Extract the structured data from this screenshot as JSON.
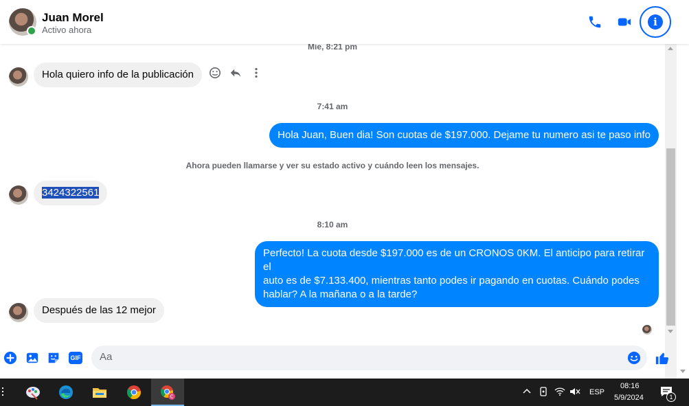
{
  "header": {
    "contact_name": "Juan Morel",
    "contact_status": "Activo ahora"
  },
  "conversation": {
    "timestamp_1": "Mie, 8:21 pm",
    "msg_1": "Hola quiero info de la publicación",
    "timestamp_2": "7:41 am",
    "msg_2": "Hola Juan, Buen dia! Son cuotas de $197.000. Dejame tu numero asi te paso info",
    "system_note": "Ahora pueden llamarse y ver su estado activo y cuándo leen los mensajes.",
    "msg_3": "3424322561",
    "timestamp_3": "8:10 am",
    "msg_4_line1": "Perfecto! La cuota desde $197.000 es de un CRONOS 0KM. El anticipo para retirar el",
    "msg_4_line2": "auto es de $7.133.400, mientras tanto podes ir pagando en cuotas. Cuándo podes",
    "msg_4_line3": "hablar? A la mañana o a la tarde?",
    "msg_5": "Después de las 12 mejor"
  },
  "composer": {
    "placeholder": "Aa",
    "gif_label": "GIF"
  },
  "taskbar": {
    "language": "ESP",
    "time": "08:16",
    "date": "5/9/2024",
    "notification_count": "1"
  },
  "colors": {
    "brand_blue": "#0866ff",
    "outgoing_bubble": "#0084ff",
    "incoming_bubble": "#f0f0f0",
    "online": "#31a24c",
    "taskbar": "#1c1c1c"
  }
}
